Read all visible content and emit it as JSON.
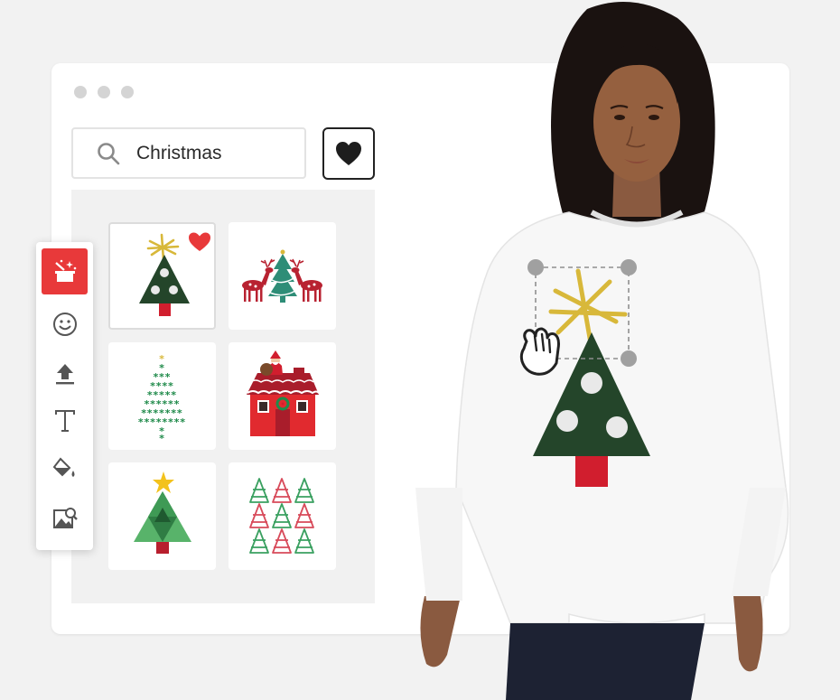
{
  "search": {
    "value": "Christmas",
    "icon": "search-icon"
  },
  "favorites_button": {
    "icon": "heart-icon"
  },
  "toolbar": {
    "tools": [
      {
        "name": "magic-wand-icon",
        "active": true
      },
      {
        "name": "smiley-icon",
        "active": false
      },
      {
        "name": "upload-icon",
        "active": false
      },
      {
        "name": "text-icon",
        "active": false
      },
      {
        "name": "paint-bucket-icon",
        "active": false
      },
      {
        "name": "image-search-icon",
        "active": false
      }
    ]
  },
  "gallery": {
    "items": [
      {
        "name": "christmas-tree-star",
        "favorited": true,
        "selected": true
      },
      {
        "name": "reindeer-and-tree",
        "favorited": false,
        "selected": false
      },
      {
        "name": "asterisk-tree",
        "favorited": false,
        "selected": false
      },
      {
        "name": "santa-house",
        "favorited": false,
        "selected": false
      },
      {
        "name": "geometric-green-tree",
        "favorited": false,
        "selected": false
      },
      {
        "name": "tree-pattern",
        "favorited": false,
        "selected": false
      }
    ]
  },
  "canvas": {
    "design": "christmas-tree-star",
    "selected_element": "star"
  },
  "colors": {
    "accent": "#e8393a",
    "tree_green": "#24452a",
    "star_gold": "#d8b83a",
    "trunk_red": "#d11e2e",
    "heart_red": "#e8393a"
  }
}
